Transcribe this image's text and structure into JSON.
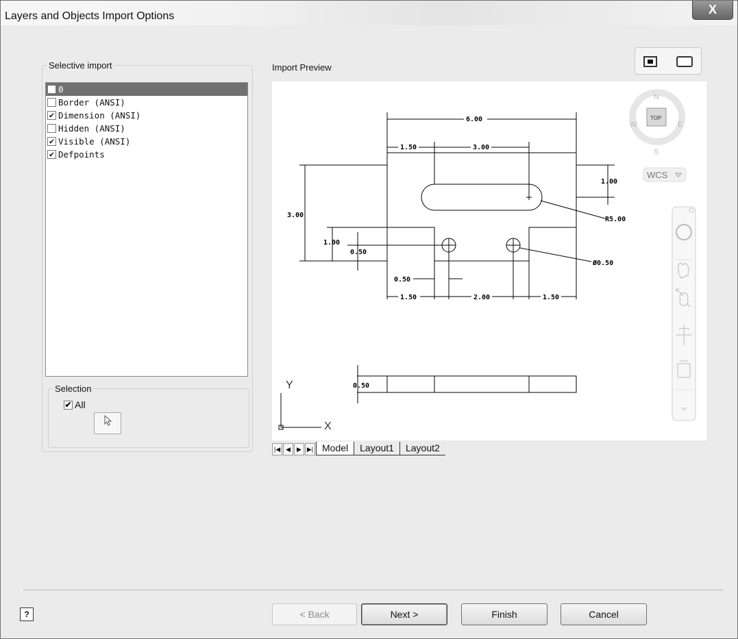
{
  "window": {
    "title": "Layers and Objects Import Options",
    "close_glyph": "X"
  },
  "selective_import": {
    "legend": "Selective import",
    "layers": [
      {
        "label": "0",
        "checked": false,
        "selected": true
      },
      {
        "label": "Border (ANSI)",
        "checked": false,
        "selected": false
      },
      {
        "label": "Dimension (ANSI)",
        "checked": true,
        "selected": false
      },
      {
        "label": "Hidden (ANSI)",
        "checked": false,
        "selected": false
      },
      {
        "label": "Visible (ANSI)",
        "checked": true,
        "selected": false
      },
      {
        "label": "Defpoints",
        "checked": true,
        "selected": false
      }
    ]
  },
  "selection": {
    "legend": "Selection",
    "all_label": "All",
    "all_checked": true,
    "pick_icon": "pointer-arrow-icon"
  },
  "preview": {
    "label": "Import Preview",
    "dims": {
      "overall_width": "6.00",
      "left_offset": "1.50",
      "slot_length": "3.00",
      "height": "3.00",
      "slot_offset": "1.00",
      "slot_radius": "R5.00",
      "notch_height": "1.00",
      "hole_offset": "0.50",
      "hole_dia": "Ø0.50",
      "hole_x": "0.50",
      "bottom_left": "1.50",
      "hole_spacing": "2.00",
      "bottom_right": "1.50",
      "thickness": "0.50"
    },
    "viewcube": {
      "n": "N",
      "s": "S",
      "e": "E",
      "w": "W",
      "face": "TOP",
      "ucs": "WCS"
    },
    "ucs_axes": {
      "x": "X",
      "y": "Y"
    },
    "tabs": [
      "Model",
      "Layout1",
      "Layout2"
    ],
    "active_tab": "Model"
  },
  "buttons": {
    "back": "< Back",
    "next": "Next >",
    "finish": "Finish",
    "cancel": "Cancel",
    "help": "?"
  }
}
